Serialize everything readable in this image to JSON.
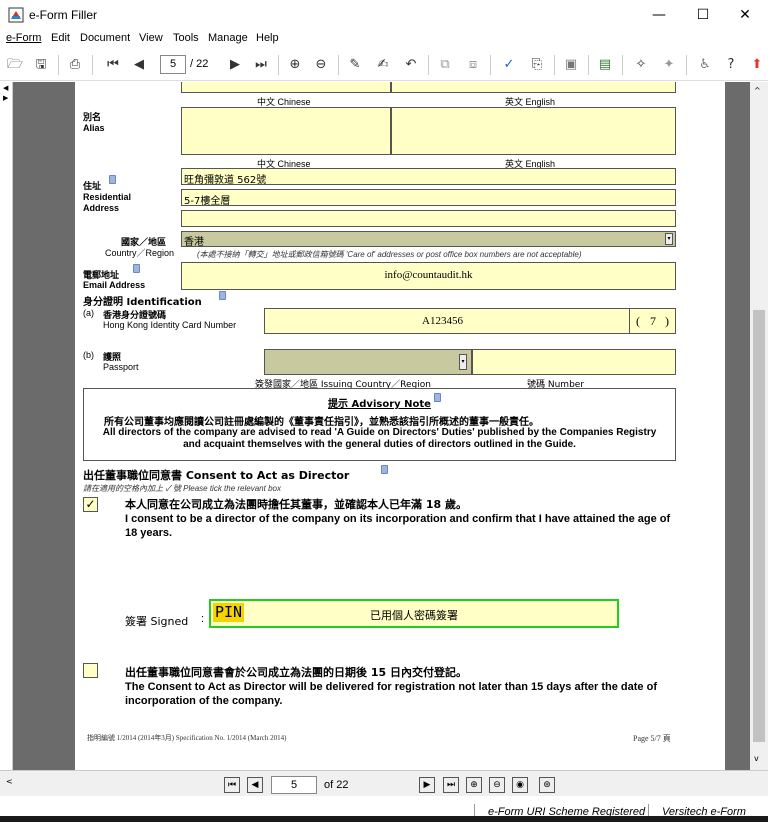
{
  "window": {
    "title": "e-Form Filler",
    "minimize": "—",
    "maximize": "☐",
    "close": "✕"
  },
  "menu": [
    "e-Form",
    "Edit",
    "Document",
    "View",
    "Tools",
    "Manage",
    "Help"
  ],
  "toolbar": {
    "page_value": "5",
    "page_total": "/ 22"
  },
  "form": {
    "lang_zh": "中文 Chinese",
    "lang_en": "英文 English",
    "alias_zh": "別名",
    "alias_en": "Alias",
    "address_zh": "住址",
    "address_en_1": "Residential",
    "address_en_2": "Address",
    "address_line1": "旺角彌敦道 562號",
    "address_line2": "5-7樓全層",
    "address_line3": "",
    "country_zh": "國家／地區",
    "country_en": "Country／Region",
    "country_value": "香港",
    "country_note": "(本處不接納「轉交」地址或郵政信箱號碼 'Care of' addresses or post office box numbers are not acceptable)",
    "email_zh": "電郵地址",
    "email_en": "Email Address",
    "email_value": "info@countaudit.hk",
    "id_heading": "身分證明 Identification",
    "hkid_prefix": "(a)",
    "hkid_zh": "香港身分證號碼",
    "hkid_en": "Hong Kong Identity Card Number",
    "hkid_value": "A123456",
    "hkid_check_open": "(",
    "hkid_check": "7",
    "hkid_check_close": ")",
    "passport_prefix": "(b)",
    "passport_zh": "護照",
    "passport_en": "Passport",
    "issuing_label": "簽發國家／地區 Issuing Country／Region",
    "number_label": "號碼 Number",
    "advisory_title": "提示 Advisory Note",
    "advisory_zh": "所有公司董事均應閱讀公司註冊處編製的《董事責任指引》，並熟悉該指引所概述的董事一般責任。",
    "advisory_en": "All directors of the company are advised to read 'A Guide on Directors' Duties' published by the Companies Registry and acquaint themselves with the general duties of directors outlined in the Guide.",
    "consent_heading": "出任董事職位同意書 Consent to Act as Director",
    "tick_hint": "請在適用的空格內加上 ✓ 號  Please tick the relevant box",
    "consent1_check": "✓",
    "consent1_zh": "本人同意在公司成立為法團時擔任其董事，並確認本人已年滿 18 歲。",
    "consent1_en": "I consent to be a director of the company on its incorporation and confirm that I have attained the age of 18 years.",
    "signed_label": "簽署 Signed",
    "signed_colon": ":",
    "pin_label": "PIN",
    "signed_value": "已用個人密碼簽署",
    "consent2_zh": "出任董事職位同意書會於公司成立為法團的日期後 15 日內交付登記。",
    "consent2_en": "The Consent to Act as Director will be delivered for registration not later than 15 days after the date of incorporation of the company.",
    "footer_left": "指明編號 1/2014 (2014年3月) Specification No. 1/2014 (March 2014)",
    "footer_right": "Page 5/7 頁"
  },
  "navigation": {
    "page_value": "5",
    "page_total": "of 22"
  },
  "status": {
    "scheme": "e-Form URI Scheme Registered",
    "vendor": "Versitech e-Form"
  }
}
